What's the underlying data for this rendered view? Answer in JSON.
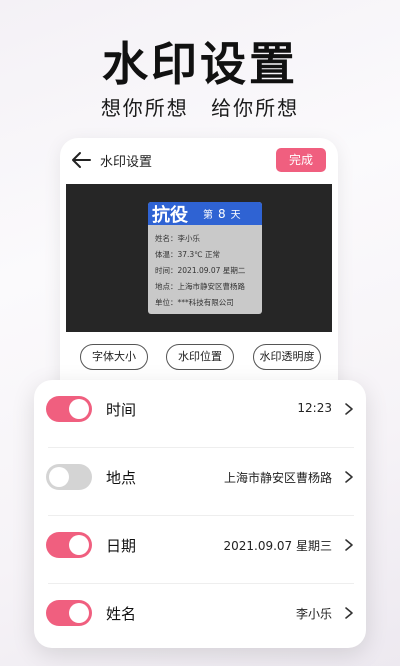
{
  "hero": {
    "title": "水印设置",
    "subtitle": "想你所想 给你所想"
  },
  "screen": {
    "nav_title": "水印设置",
    "done_label": "完成",
    "watermark": {
      "brand": "抗役",
      "day_prefix": "第",
      "day_number": "8",
      "day_suffix": "天",
      "rows": [
        "姓名：李小乐",
        "体温：37.3℃  正常",
        "时间：2021.09.07  星期二",
        "地点：上海市静安区曹杨路",
        "单位：***科技有限公司"
      ]
    },
    "chips": [
      "字体大小",
      "水印位置",
      "水印透明度"
    ]
  },
  "settings": [
    {
      "label": "时间",
      "value": "12:23",
      "enabled": true
    },
    {
      "label": "地点",
      "value": "上海市静安区曹杨路",
      "enabled": false
    },
    {
      "label": "日期",
      "value": "2021.09.07 星期三",
      "enabled": true
    },
    {
      "label": "姓名",
      "value": "李小乐",
      "enabled": true
    }
  ],
  "colors": {
    "accent": "#f05f7f",
    "toggle_off": "#d4d4d4",
    "watermark_header": "#2f63d3",
    "preview_bg": "#262626"
  },
  "icons": {
    "back": "back-arrow-icon",
    "chevron": "chevron-right-icon"
  }
}
